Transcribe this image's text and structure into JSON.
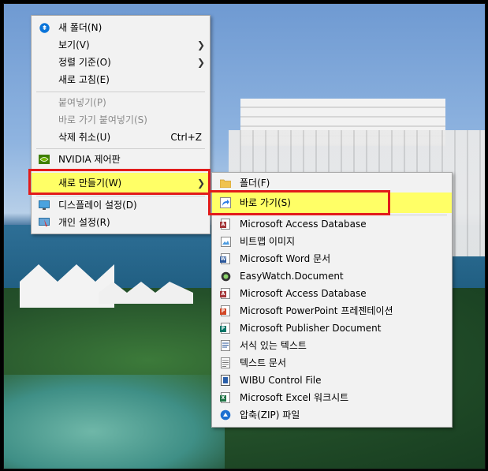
{
  "main_menu": {
    "items": [
      {
        "label": "새 폴더(N)",
        "icon": "dropbox-icon"
      },
      {
        "label": "보기(V)",
        "submenu": true
      },
      {
        "label": "정렬 기준(O)",
        "submenu": true
      },
      {
        "label": "새로 고침(E)"
      },
      {
        "label": "붙여넣기(P)",
        "disabled": true
      },
      {
        "label": "바로 가기 붙여넣기(S)",
        "disabled": true
      },
      {
        "label": "삭제 취소(U)",
        "shortcut": "Ctrl+Z"
      },
      {
        "label": "NVIDIA 제어판",
        "icon": "nvidia-icon"
      },
      {
        "label": "새로 만들기(W)",
        "submenu": true,
        "highlighted": true
      },
      {
        "label": "디스플레이 설정(D)",
        "icon": "display-icon"
      },
      {
        "label": "개인 설정(R)",
        "icon": "personalize-icon"
      }
    ]
  },
  "sub_menu": {
    "items": [
      {
        "label": "폴더(F)",
        "icon": "folder-icon"
      },
      {
        "label": "바로 가기(S)",
        "icon": "shortcut-icon",
        "highlighted": true
      },
      {
        "label": "Microsoft Access Database",
        "icon": "access-icon"
      },
      {
        "label": "비트맵 이미지",
        "icon": "bitmap-icon"
      },
      {
        "label": "Microsoft Word 문서",
        "icon": "word-icon"
      },
      {
        "label": "EasyWatch.Document",
        "icon": "easywatch-icon"
      },
      {
        "label": "Microsoft Access Database",
        "icon": "access-icon"
      },
      {
        "label": "Microsoft PowerPoint 프레젠테이션",
        "icon": "powerpoint-icon"
      },
      {
        "label": "Microsoft Publisher Document",
        "icon": "publisher-icon"
      },
      {
        "label": "서식 있는 텍스트",
        "icon": "rtf-icon"
      },
      {
        "label": "텍스트 문서",
        "icon": "text-icon"
      },
      {
        "label": "WIBU Control File",
        "icon": "wibu-icon"
      },
      {
        "label": "Microsoft Excel 워크시트",
        "icon": "excel-icon"
      },
      {
        "label": "압축(ZIP) 파일",
        "icon": "zip-icon"
      }
    ]
  },
  "colors": {
    "highlight": "#ffff66",
    "annotation_border": "#e21b1b",
    "access": "#a4373a",
    "word": "#2b579a",
    "powerpoint": "#d24726",
    "publisher": "#077568",
    "excel": "#217346"
  }
}
